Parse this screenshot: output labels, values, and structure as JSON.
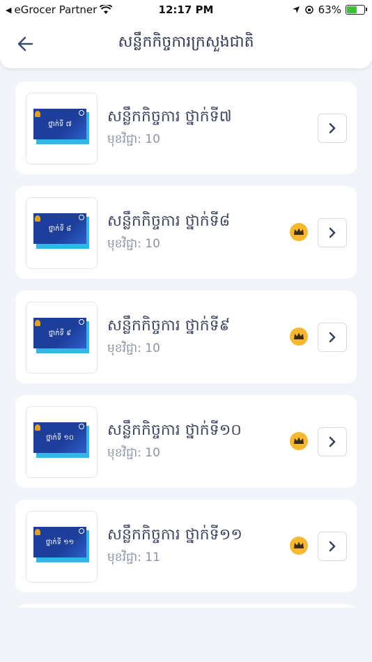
{
  "status_bar": {
    "carrier": "eGrocer Partner",
    "time": "12:17 PM",
    "battery": "63%",
    "battery_level": 0.63
  },
  "header": {
    "title": "សន្លឹកកិច្ចការក្រសួងជាតិ"
  },
  "items": [
    {
      "title": "សន្លឹកកិច្ចការ ថ្នាក់ទី៧",
      "subtitle": "មុខវិជ្ជា: 10",
      "cover_label": "ថ្នាក់ទី ៧",
      "premium": false
    },
    {
      "title": "សន្លឹកកិច្ចការ ថ្នាក់ទី៨",
      "subtitle": "មុខវិជ្ជា: 10",
      "cover_label": "ថ្នាក់ទី ៨",
      "premium": true
    },
    {
      "title": "សន្លឹកកិច្ចការ ថ្នាក់ទី៩",
      "subtitle": "មុខវិជ្ជា: 10",
      "cover_label": "ថ្នាក់ទី ៩",
      "premium": true
    },
    {
      "title": "សន្លឹកកិច្ចការ ថ្នាក់ទី១០",
      "subtitle": "មុខវិជ្ជា: 10",
      "cover_label": "ថ្នាក់ទី ១០",
      "premium": true
    },
    {
      "title": "សន្លឹកកិច្ចការ ថ្នាក់ទី១១",
      "subtitle": "មុខវិជ្ជា: 11",
      "cover_label": "ថ្នាក់ទី ១១",
      "premium": true
    }
  ],
  "colors": {
    "background": "#f1f4f8",
    "cover_front": "#1d3e9b",
    "cover_back": "#33b6e8",
    "premium": "#f5b82e"
  }
}
